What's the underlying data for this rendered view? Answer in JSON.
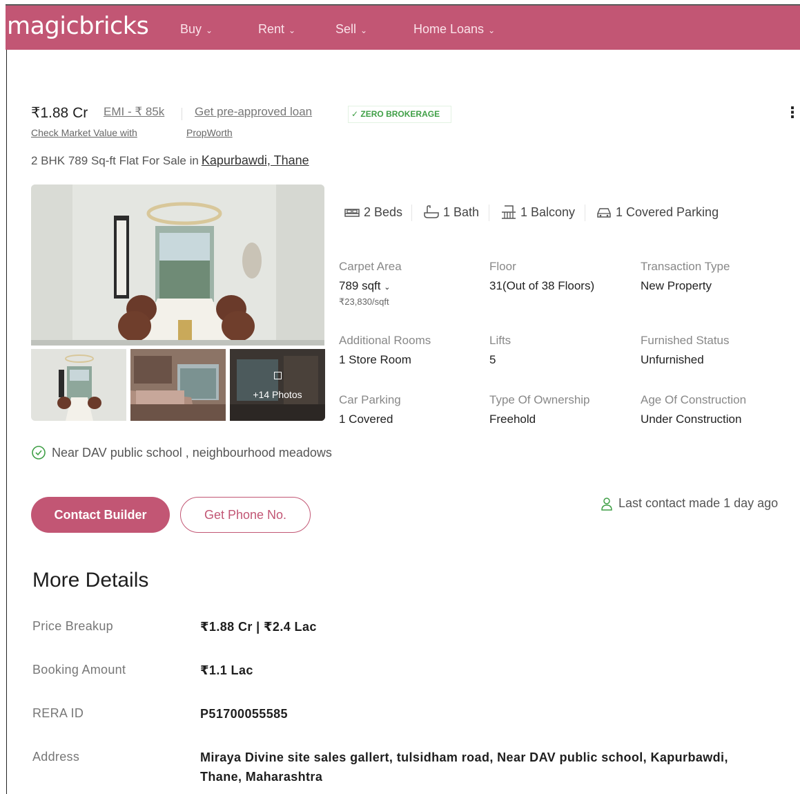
{
  "header": {
    "logo": "magicbricks",
    "nav": [
      {
        "label": "Buy"
      },
      {
        "label": "Rent"
      },
      {
        "label": "Sell"
      },
      {
        "label": "Home Loans"
      }
    ]
  },
  "listing": {
    "price": "₹1.88 Cr",
    "emi": "EMI - ₹ 85k",
    "preapproved": "Get pre-approved loan",
    "zero_brokerage": "ZERO BROKERAGE",
    "market_value_1": "Check Market Value with",
    "market_value_2": "PropWorth",
    "title_prefix": "2 BHK 789 Sq-ft Flat For Sale in",
    "title_location": "Kapurbawdi, Thane",
    "photos_label": "+14 Photos",
    "amenities": {
      "beds": "2 Beds",
      "bath": "1 Bath",
      "balcony": "1 Balcony",
      "parking": "1 Covered Parking"
    },
    "specs": {
      "carpet_area": {
        "label": "Carpet Area",
        "value": "789 sqft",
        "sub": "₹23,830/sqft"
      },
      "floor": {
        "label": "Floor",
        "value": "31(Out of 38 Floors)"
      },
      "transaction": {
        "label": "Transaction Type",
        "value": "New Property"
      },
      "additional_rooms": {
        "label": "Additional Rooms",
        "value": "1 Store Room"
      },
      "lifts": {
        "label": "Lifts",
        "value": "5"
      },
      "furnished": {
        "label": "Furnished Status",
        "value": "Unfurnished"
      },
      "car_parking": {
        "label": "Car Parking",
        "value": "1 Covered"
      },
      "ownership": {
        "label": "Type Of Ownership",
        "value": "Freehold"
      },
      "age": {
        "label": "Age Of Construction",
        "value": "Under Construction"
      }
    },
    "near": "Near DAV public school , neighbourhood meadows",
    "contact_button": "Contact Builder",
    "phone_button": "Get Phone No.",
    "last_contact": "Last contact made 1 day ago"
  },
  "more_details": {
    "title": "More Details",
    "rows": [
      {
        "label": "Price Breakup",
        "value": "₹1.88 Cr | ₹2.4 Lac"
      },
      {
        "label": "Booking Amount",
        "value": "₹1.1 Lac"
      },
      {
        "label": "RERA ID",
        "value": "P51700055585"
      },
      {
        "label": "Address",
        "value": "Miraya Divine site sales gallert, tulsidham road, Near DAV public school, Kapurbawdi, Thane, Maharashtra"
      }
    ]
  },
  "colors": {
    "brand": "#c25674",
    "success": "#3f9f46"
  },
  "icons": [
    "chevron-down-icon",
    "check-icon",
    "kebab-menu-icon",
    "gallery-icon",
    "bed-icon",
    "bath-icon",
    "balcony-icon",
    "car-icon",
    "check-circle-icon",
    "user-icon"
  ]
}
